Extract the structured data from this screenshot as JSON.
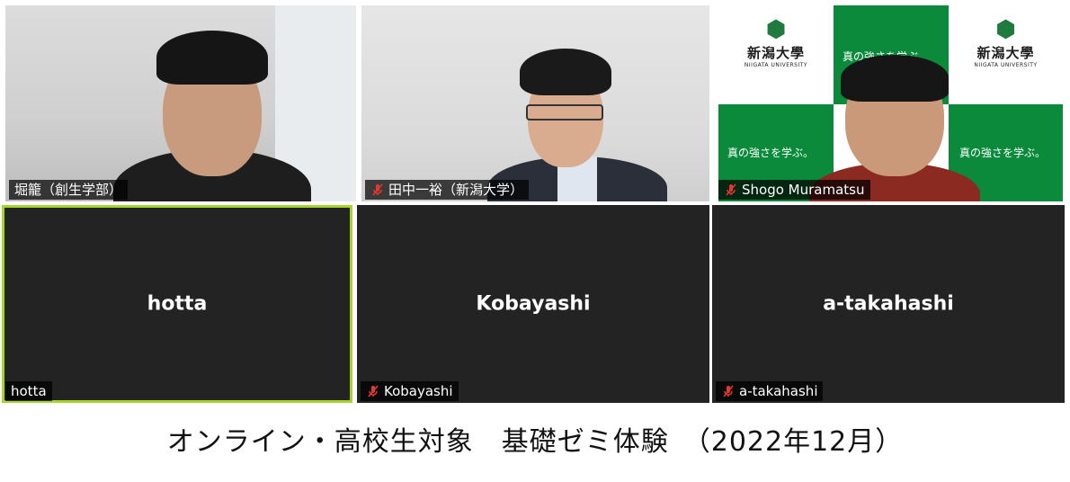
{
  "participants": [
    {
      "display_name": "堀籠（創生学部）",
      "muted": false,
      "video": true
    },
    {
      "display_name": "田中一裕（新潟大学）",
      "muted": true,
      "video": true
    },
    {
      "display_name": "Shogo Muramatsu",
      "muted": true,
      "video": true
    },
    {
      "display_name": "hotta",
      "center_name": "hotta",
      "muted": false,
      "video": false,
      "active_speaker": true
    },
    {
      "display_name": "Kobayashi",
      "center_name": "Kobayashi",
      "muted": true,
      "video": false
    },
    {
      "display_name": "a-takahashi",
      "center_name": "a-takahashi",
      "muted": true,
      "video": false
    }
  ],
  "backdrop": {
    "logo_text": "新潟大學",
    "logo_sub": "NIIGATA UNIVERSITY",
    "slogan": "真の強さを学ぶ。"
  },
  "caption": "オンライン・高校生対象　基礎ゼミ体験　（2022年12月）",
  "colors": {
    "active_border": "#a6d52a",
    "tile_bg": "#232323",
    "mic_muted": "#e5372f",
    "backdrop_green": "#0a8a3a"
  }
}
